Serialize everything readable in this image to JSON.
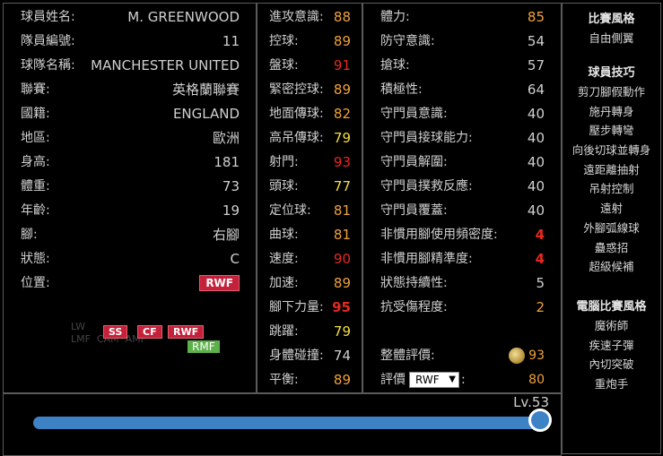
{
  "player": {
    "rows": [
      {
        "label": "球員姓名:",
        "value": "M. GREENWOOD"
      },
      {
        "label": "隊員編號:",
        "value": "11"
      },
      {
        "label": "球隊名稱:",
        "value": "MANCHESTER UNITED"
      },
      {
        "label": "聯賽:",
        "value": "英格蘭聯賽"
      },
      {
        "label": "國籍:",
        "value": "ENGLAND"
      },
      {
        "label": "地區:",
        "value": "歐洲"
      },
      {
        "label": "身高:",
        "value": "181"
      },
      {
        "label": "體重:",
        "value": "73"
      },
      {
        "label": "年齡:",
        "value": "19"
      },
      {
        "label": "腳:",
        "value": "右腳"
      },
      {
        "label": "狀態:",
        "value": "C"
      },
      {
        "label": "位置:",
        "value": "RWF"
      }
    ],
    "positions": [
      "SS",
      "CF",
      "RWF",
      "RMF"
    ],
    "faded_labels": [
      "LW",
      "LMF",
      "CAM",
      "AMF",
      "RMF",
      "RW"
    ]
  },
  "stats_mid": [
    {
      "label": "進攻意識:",
      "value": "88",
      "color": "#f0a13a"
    },
    {
      "label": "控球:",
      "value": "89",
      "color": "#f0a13a"
    },
    {
      "label": "盤球:",
      "value": "91",
      "color": "#e8281e"
    },
    {
      "label": "緊密控球:",
      "value": "89",
      "color": "#f0a13a"
    },
    {
      "label": "地面傳球:",
      "value": "82",
      "color": "#f0a13a"
    },
    {
      "label": "高吊傳球:",
      "value": "79",
      "color": "#f3e03a"
    },
    {
      "label": "射門:",
      "value": "93",
      "color": "#e8281e"
    },
    {
      "label": "頭球:",
      "value": "77",
      "color": "#f3e03a"
    },
    {
      "label": "定位球:",
      "value": "81",
      "color": "#f0a13a"
    },
    {
      "label": "曲球:",
      "value": "81",
      "color": "#f0a13a"
    },
    {
      "label": "速度:",
      "value": "90",
      "color": "#e8281e"
    },
    {
      "label": "加速:",
      "value": "89",
      "color": "#f0a13a"
    },
    {
      "label": "腳下力量:",
      "value": "95",
      "color": "#e8281e"
    },
    {
      "label": "跳躍:",
      "value": "79",
      "color": "#f3e03a"
    },
    {
      "label": "身體碰撞:",
      "value": "74",
      "color": "#d0d0d0"
    },
    {
      "label": "平衡:",
      "value": "89",
      "color": "#f0a13a"
    }
  ],
  "stats_right": [
    {
      "label": "體力:",
      "value": "85",
      "color": "#f0a13a"
    },
    {
      "label": "防守意識:",
      "value": "54",
      "color": "#d0d0d0"
    },
    {
      "label": "搶球:",
      "value": "57",
      "color": "#d0d0d0"
    },
    {
      "label": "積極性:",
      "value": "64",
      "color": "#d0d0d0"
    },
    {
      "label": "守門員意識:",
      "value": "40",
      "color": "#d0d0d0"
    },
    {
      "label": "守門員接球能力:",
      "value": "40",
      "color": "#d0d0d0"
    },
    {
      "label": "守門員解圍:",
      "value": "40",
      "color": "#d0d0d0"
    },
    {
      "label": "守門員撲救反應:",
      "value": "40",
      "color": "#d0d0d0"
    },
    {
      "label": "守門員覆蓋:",
      "value": "40",
      "color": "#d0d0d0"
    },
    {
      "label": "非慣用腳使用頻密度:",
      "value": "4",
      "color": "#e8281e"
    },
    {
      "label": "非慣用腳精準度:",
      "value": "4",
      "color": "#e8281e"
    },
    {
      "label": "狀態持續性:",
      "value": "5",
      "color": "#d0d0d0"
    },
    {
      "label": "抗受傷程度:",
      "value": "2",
      "color": "#f0a13a"
    }
  ],
  "overall": {
    "label": "整體評價:",
    "value": "93"
  },
  "rating": {
    "label": "評價",
    "selected": "RWF",
    "value": "80"
  },
  "sidebar": {
    "style_title": "比賽風格",
    "style_value": "自由側翼",
    "skills_title": "球員技巧",
    "skills": [
      "剪刀腳假動作",
      "施丹轉身",
      "壓步轉彎",
      "向後切球並轉身",
      "遠距離抽射",
      "吊射控制",
      "遠射",
      "外腳弧線球",
      "蠱惑招",
      "超級候補"
    ],
    "com_title": "電腦比賽風格",
    "com_styles": [
      "魔術師",
      "疾速子彈",
      "內切突破",
      "重炮手"
    ]
  },
  "level": {
    "label": "Lv.53",
    "progress": 1.0
  }
}
